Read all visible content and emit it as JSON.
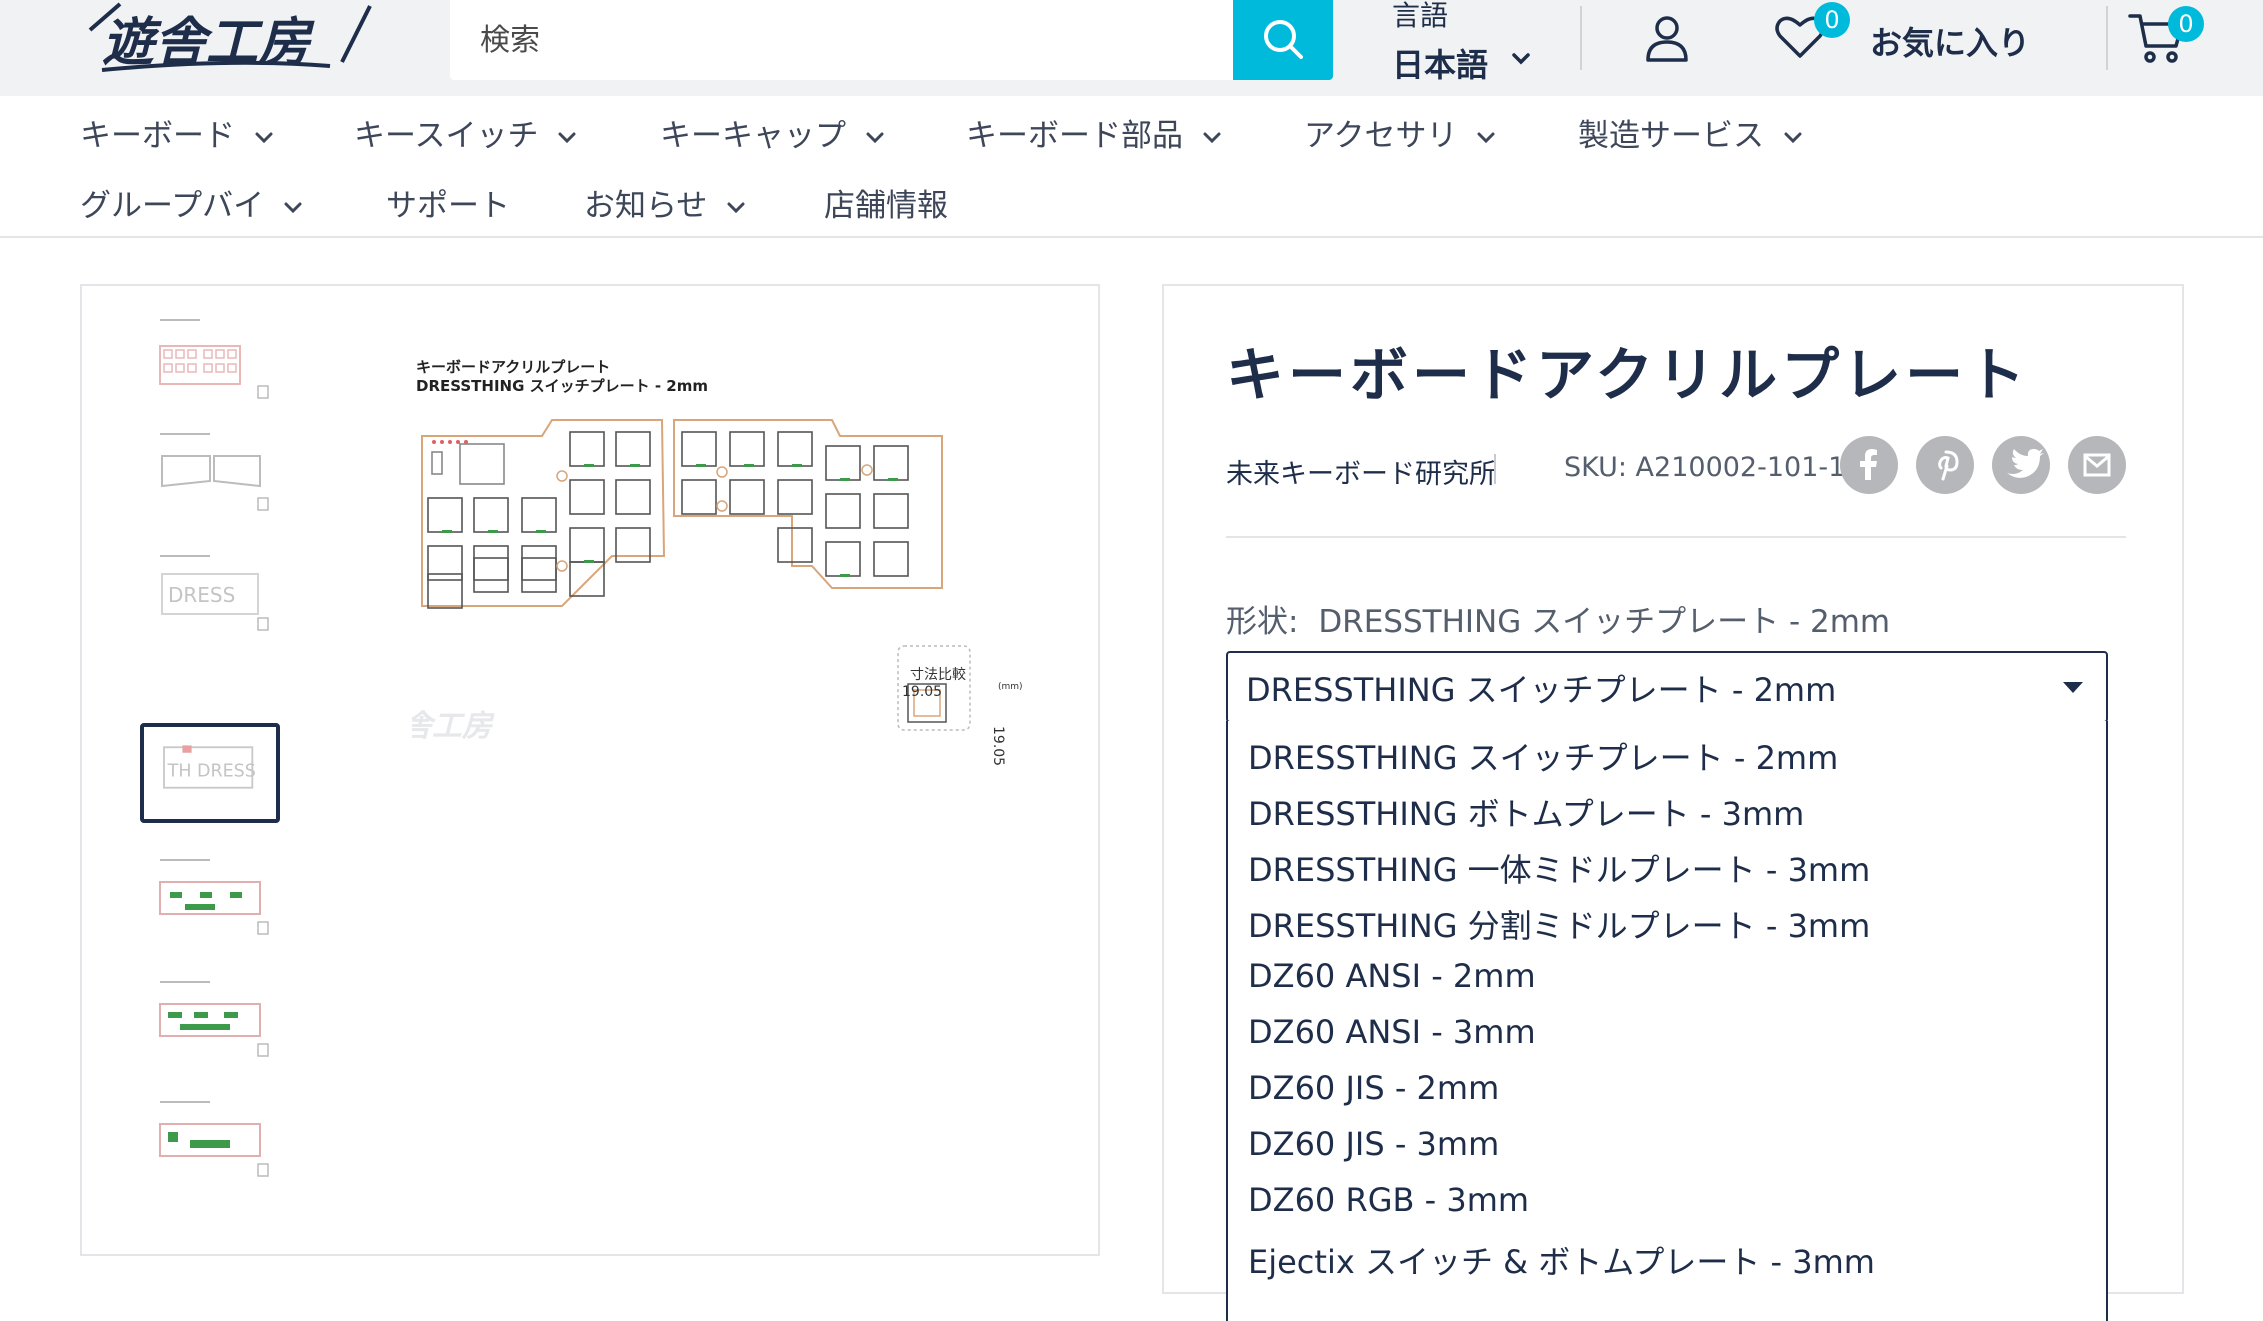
{
  "header": {
    "logo_text": "遊舎工房",
    "search_placeholder": "検索",
    "language_label": "言語",
    "language_value": "日本語",
    "wishlist_count": "0",
    "wishlist_label": "お気に入り",
    "cart_count": "0"
  },
  "nav": {
    "items": [
      {
        "label": "キーボード"
      },
      {
        "label": "キースイッチ"
      },
      {
        "label": "キーキャップ"
      },
      {
        "label": "キーボード部品"
      },
      {
        "label": "アクセサリ"
      },
      {
        "label": "製造サービス"
      },
      {
        "label": "グループバイ"
      },
      {
        "label": "サポート"
      },
      {
        "label": "お知らせ"
      },
      {
        "label": "店舗情報"
      }
    ]
  },
  "gallery": {
    "image_title_line1": "キーボードアクリルプレート",
    "image_title_line2": "DRESSTHING スイッチプレート - 2mm",
    "compare_label": "寸法比較",
    "compare_width": "19.05",
    "compare_height": "19.05",
    "compare_unit": "(mm)",
    "watermark": "遊舎工房"
  },
  "product": {
    "title": "キーボードアクリルプレート",
    "vendor": "未来キーボード研究所",
    "sku": "SKU: A210002-101-1",
    "shape_label": "形状:",
    "shape_value": "DRESSTHING スイッチプレート - 2mm",
    "select_value": "DRESSTHING スイッチプレート - 2mm",
    "options": [
      "DRESSTHING スイッチプレート - 2mm",
      "DRESSTHING ボトムプレート - 3mm",
      "DRESSTHING 一体ミドルプレート - 3mm",
      "DRESSTHING 分割ミドルプレート - 3mm",
      "DZ60 ANSI - 2mm",
      "DZ60 ANSI - 3mm",
      "DZ60 JIS - 2mm",
      "DZ60 JIS - 3mm",
      "DZ60 RGB - 3mm",
      "Ejectix スイッチ & ボトムプレート - 3mm"
    ]
  },
  "colors": {
    "accent": "#00badb",
    "navy": "#1e2d4a",
    "header_bg": "#f1f2f4"
  }
}
